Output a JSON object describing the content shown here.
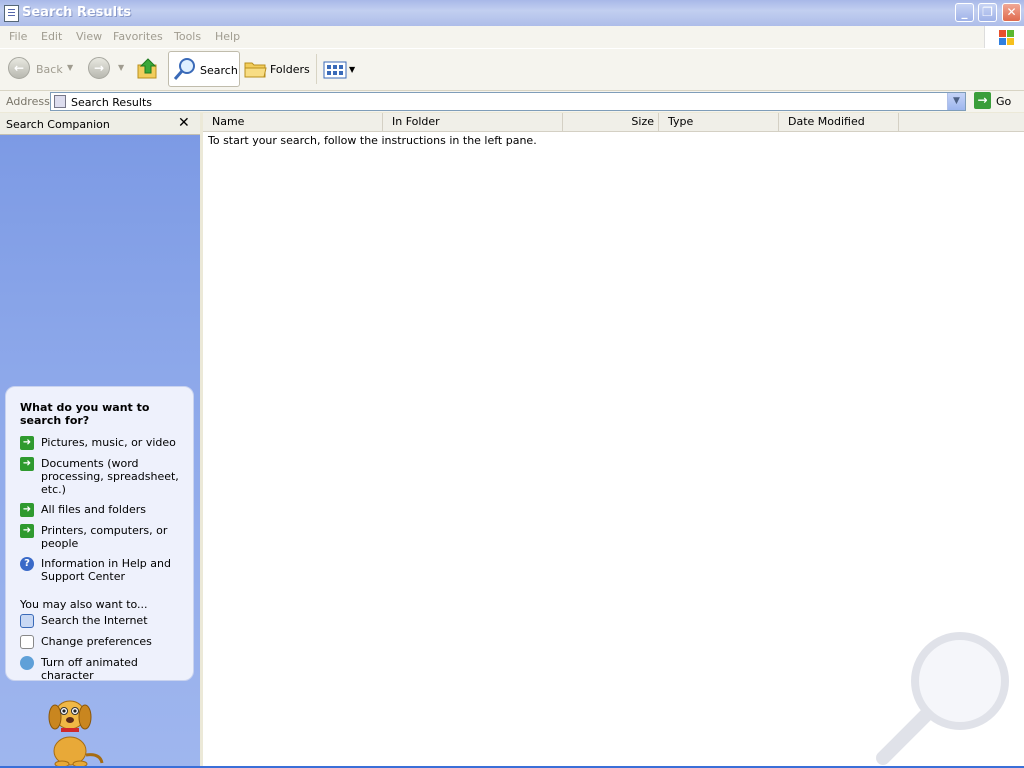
{
  "window": {
    "title": "Search Results",
    "minimize": "_",
    "restore": "❐",
    "close": "✕"
  },
  "menu": [
    "File",
    "Edit",
    "View",
    "Favorites",
    "Tools",
    "Help"
  ],
  "toolbar": {
    "back": "Back",
    "search": "Search",
    "folders": "Folders"
  },
  "address": {
    "label": "Address",
    "value": "Search Results",
    "go": "Go"
  },
  "search_companion": {
    "title": "Search Companion",
    "close": "✕",
    "heading": "What do you want to search for?",
    "options": [
      "Pictures, music, or video",
      "Documents (word processing, spreadsheet, etc.)",
      "All files and folders",
      "Printers, computers, or people",
      "Information in Help and Support Center"
    ],
    "also_heading": "You may also want to...",
    "also": [
      "Search the Internet",
      "Change preferences",
      "Turn off animated character"
    ]
  },
  "results": {
    "columns": [
      "Name",
      "In Folder",
      "Size",
      "Type",
      "Date Modified"
    ],
    "message": "To start your search, follow the instructions in the left pane."
  },
  "colors": {
    "title_bar": "#aebde9",
    "pane_blue": "#8da8ea",
    "go_green": "#3a9e3a"
  }
}
